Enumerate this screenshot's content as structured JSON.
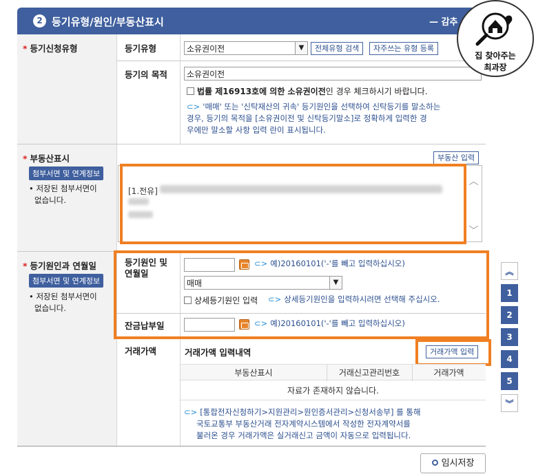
{
  "section": {
    "number": "2",
    "title": "등기유형/원인/부동산표시",
    "collapse_label": "— 감추"
  },
  "badge": {
    "line1": "집 찾아주는",
    "line2": "최과장"
  },
  "registration_type": {
    "label": "등기신청유형",
    "type_label": "등기유형",
    "type_value": "소유권이전",
    "search_all_btn": "전체유형 검색",
    "frequent_btn": "자주쓰는 유형 등록",
    "purpose_label": "등기의 목적",
    "purpose_value": "소유권이전",
    "law_check_bold": "법률 제16913호에 의한 소유권이전",
    "law_check_rest": "인 경우 체크하시기 바랍니다.",
    "hint_lines": [
      "'매매' 또는 '신탁재산의 귀속' 등기원인을 선택하여 신탁등기를 말소하는",
      "경우, 등기의 목적을 [소유권이전 및 신탁등기말소]로 정확하게 입력한 경",
      "우에만 말소할 사항 입력 란이 표시됩니다."
    ]
  },
  "property": {
    "label": "부동산표시",
    "attach_btn": "첨부서면 및 연계정보",
    "attach_note_lines": [
      "저장된 첨부서면이",
      "없습니다."
    ],
    "input_btn": "부동산 입력",
    "text_prefix": "[1.전유]"
  },
  "cause": {
    "label": "등기원인과 연월일",
    "attach_btn": "첨부서면 및 연계정보",
    "attach_note_lines": [
      "저장된 첨부서면이",
      "없습니다."
    ],
    "date_label_lines": [
      "등기원인 및",
      "연월일"
    ],
    "date_hint": "예)20160101('-'를 빼고 입력하십시오)",
    "cause_value": "매매",
    "detail_check": "상세등기원인 입력",
    "detail_hint": "상세등기원인을 입력하시려면 선택해 주십시오.",
    "balance_label": "잔금납부일",
    "balance_hint": "예)20160101('-'를 빼고 입력하십시오)"
  },
  "price": {
    "label": "거래가액",
    "history_title": "거래가액 입력내역",
    "input_btn": "거래가액 입력",
    "columns": [
      "부동산표시",
      "거래신고관리번호",
      "거래가액"
    ],
    "empty_message": "자료가 존재하지 않습니다.",
    "hint_lines": [
      "[통합전자신청하기>지원관리>원인증서관리>신청서송부] 를 통해",
      "국토교통부 부동산거래 전자계약시스템에서 작성한 전자계약서를",
      "불러온 경우 거래가액은 실거래신고 금액이 자동으로 입력됩니다."
    ]
  },
  "side_nav": [
    "1",
    "2",
    "3",
    "4",
    "5"
  ],
  "save_label": "임시저장",
  "colors": {
    "header": "#3f5f9e",
    "highlight": "#f07f22",
    "required": "#dd2222"
  }
}
